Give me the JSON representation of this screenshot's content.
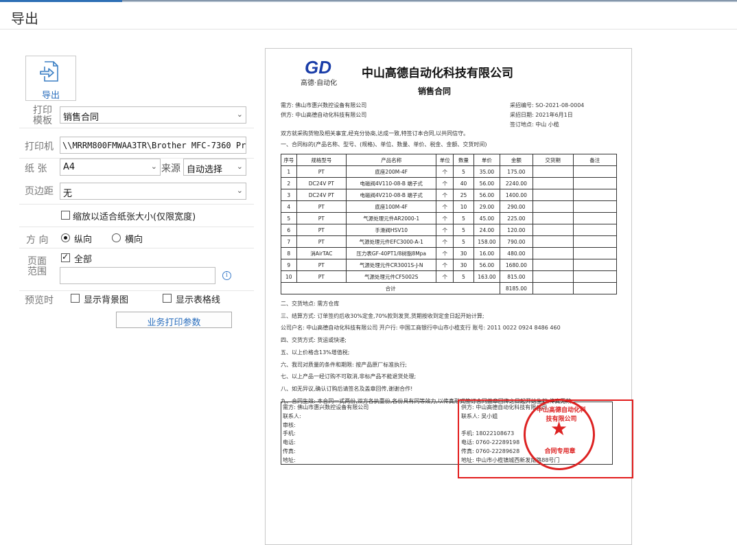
{
  "window": {
    "title": "导出"
  },
  "toolbar": {
    "export_label": "导出",
    "export_icon": "export-icon"
  },
  "form": {
    "template_label": "打印模板",
    "template_value": "销售合同",
    "printer_label": "打印机",
    "printer_value": "\\\\MRRM800FMWAA3TR\\Brother MFC-7360 Print",
    "paper_label": "纸 张",
    "paper_value": "A4",
    "source_label": "来源",
    "source_value": "自动选择",
    "margin_label": "页边距",
    "margin_value": "无",
    "fit_label": "缩放以适合纸张大小(仅限宽度)",
    "fit_checked": false,
    "orientation_label": "方 向",
    "portrait_label": "纵向",
    "landscape_label": "横向",
    "orientation_value": "portrait",
    "range_label": "页面范围",
    "all_label": "全部",
    "all_checked": true,
    "range_input": "",
    "preview_label": "预览时",
    "show_bg_label": "显示背景图",
    "show_bg_checked": false,
    "show_grid_label": "显示表格线",
    "show_grid_checked": false,
    "biz_params_label": "业务打印参数"
  },
  "doc": {
    "logo_text": "GD",
    "logo_caption": "高德·自动化",
    "company": "中山高德自动化科技有限公司",
    "title": "销售合同",
    "buyer": "需方:  佛山市惠兴数控设备有限公司",
    "seller": "供方:  中山高德自动化科技有限公司",
    "contract_no": "采招编号:  SO-2021-08-0004",
    "sign_date": "采招日期:  2021年6月1日",
    "sign_place": "签订地点:  中山 小榄",
    "intro": "双方就采购货物及相关事宜,经充分协商,达成一致,特签订本合同,以共同信守。",
    "sec1": "一、合同标的(产品名称、型号、(规格)、单位、数量、单价、税金、金额、交货时间)",
    "headers": [
      "序号",
      "规格型号",
      "产品名称",
      "单位",
      "数量",
      "单价",
      "金额",
      "交货期",
      "备注"
    ],
    "rows": [
      [
        "1",
        "PT",
        "底座200M-4F",
        "个",
        "5",
        "35.00",
        "175.00",
        "",
        ""
      ],
      [
        "2",
        "DC24V PT",
        "电磁阀4V110-08-B 端子式",
        "个",
        "40",
        "56.00",
        "2240.00",
        "",
        ""
      ],
      [
        "3",
        "DC24V PT",
        "电磁阀4V210-08-B 端子式",
        "个",
        "25",
        "56.00",
        "1400.00",
        "",
        ""
      ],
      [
        "4",
        "PT",
        "底座100M-4F",
        "个",
        "10",
        "29.00",
        "290.00",
        "",
        ""
      ],
      [
        "5",
        "PT",
        "气源处理元件AR2000-1",
        "个",
        "5",
        "45.00",
        "225.00",
        "",
        ""
      ],
      [
        "6",
        "PT",
        "手滑阀HSV10",
        "个",
        "5",
        "24.00",
        "120.00",
        "",
        ""
      ],
      [
        "7",
        "PT",
        "气源处理元件EFC3000-A-1",
        "个",
        "5",
        "158.00",
        "790.00",
        "",
        ""
      ],
      [
        "8",
        "消AirTAC",
        "压力表GF-40PT1/8树脂8Mpa",
        "个",
        "30",
        "16.00",
        "480.00",
        "",
        ""
      ],
      [
        "9",
        "PT",
        "气源处理元件CR3001S-J-N",
        "个",
        "30",
        "56.00",
        "1680.00",
        "",
        ""
      ],
      [
        "10",
        "PT",
        "气源处理元件CF5002S",
        "个",
        "5",
        "163.00",
        "815.00",
        "",
        ""
      ]
    ],
    "total_label": "合计",
    "total_value": "8185.00",
    "clauses": [
      "二、交货地点: 需方仓库",
      "三、结算方式: 订单签约后收30%定金,70%款到发货,货期按收到定金日起开始计算;",
      "公司户名: 中山高德自动化科技有限公司      开户行: 中国工商银行中山市小榄支行      账号: 2011 0022 0924 8486 460",
      "四、交货方式: 货运或快递;",
      "五、以上价格含13%增值税;",
      "六、我司对质量的条件和期限: 按产品原厂标准执行;",
      "七、以上产品一经订购不可取消,非标产品不能退货处理;",
      "八、如无异议,确认订购后请签名及盖章回传,谢谢合作!",
      "九、合同生效: 本合同一式两份,双方各执壹份,各份具有同等效力,以传真形式签订合同盖章回传之日起开始生效,传真无效"
    ],
    "buyer_block": [
      "需方:  佛山市惠兴数控设备有限公司",
      "联系人:",
      "审核:",
      "手机:",
      "电话:",
      "传真:",
      "地址:"
    ],
    "seller_block": [
      "供方:  中山高德自动化科技有限公司",
      "联系人:  吴小姐",
      "",
      "手机:  18022108673",
      "电话:  0760-22289198",
      "传真:  0760-22289628",
      "地址:  中山市小榄镇城西新发南路88号门"
    ],
    "seal_name": "中山高德自动化科技有限公司",
    "seal_label": "合同专用章"
  },
  "colors": {
    "accent": "#2a6ebd",
    "highlight_box": "#e21b1b",
    "seal": "#dd2222"
  }
}
